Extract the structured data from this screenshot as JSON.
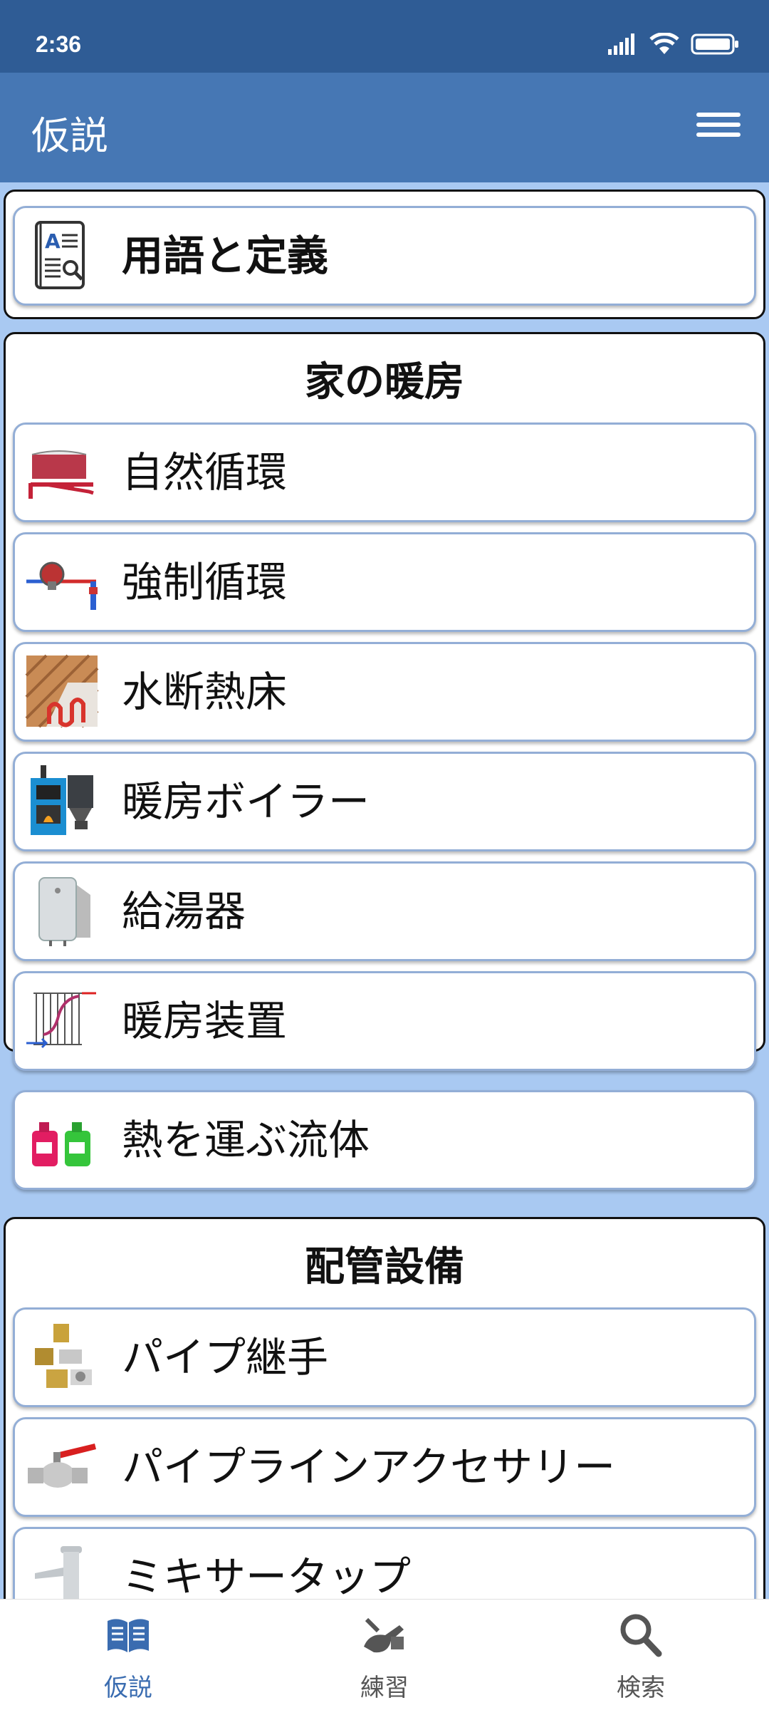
{
  "status_bar": {
    "time": "2:36"
  },
  "app_bar": {
    "title": "仮説"
  },
  "sections": [
    {
      "items": [
        {
          "label": "用語と定義",
          "icon": "glossary-book-icon"
        }
      ]
    },
    {
      "title": "家の暖房",
      "items": [
        {
          "label": "自然循環",
          "icon": "natural-circulation-icon"
        },
        {
          "label": "強制循環",
          "icon": "circulation-pump-icon"
        },
        {
          "label": "水断熱床",
          "icon": "heated-floor-icon"
        },
        {
          "label": "暖房ボイラー",
          "icon": "boiler-icon"
        },
        {
          "label": "給湯器",
          "icon": "water-heater-icon"
        },
        {
          "label": "暖房装置",
          "icon": "radiator-icon"
        },
        {
          "label": "熱を運ぶ流体",
          "icon": "coolant-bottles-icon"
        }
      ]
    },
    {
      "title": "配管設備",
      "items": [
        {
          "label": "パイプ継手",
          "icon": "pipe-fittings-icon"
        },
        {
          "label": "パイプラインアクセサリー",
          "icon": "ball-valve-icon"
        },
        {
          "label": "ミキサータップ",
          "icon": "mixer-tap-icon"
        }
      ]
    }
  ],
  "bottom_nav": [
    {
      "label": "仮説",
      "icon": "book-icon",
      "active": true
    },
    {
      "label": "練習",
      "icon": "tools-icon",
      "active": false
    },
    {
      "label": "検索",
      "icon": "search-icon",
      "active": false
    }
  ],
  "colors": {
    "status_bar": "#2f5c95",
    "app_bar": "#4677b4",
    "background": "#a9c9f2",
    "item_border": "#93aed6",
    "nav_active": "#3a6cb0"
  }
}
